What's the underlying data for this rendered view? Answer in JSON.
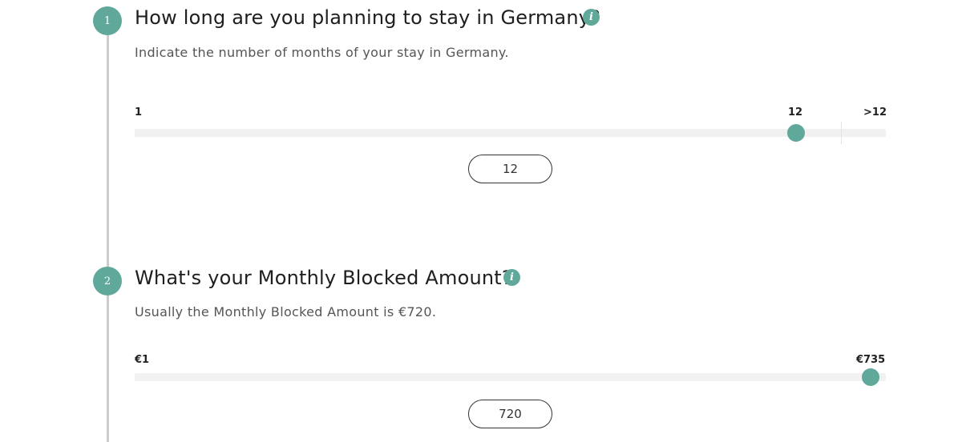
{
  "steps": [
    {
      "number": "1",
      "title": "How long are you planning to stay in Germany?",
      "description": "Indicate the number of months of your stay in Germany.",
      "info_icon": "info-icon",
      "slider": {
        "min_label": "1",
        "current_label": "12",
        "max_label": ">12",
        "value": 12,
        "input_value": "12"
      }
    },
    {
      "number": "2",
      "title": "What's your Monthly Blocked Amount?",
      "description": "Usually the Monthly Blocked Amount is €720.",
      "info_icon": "info-icon",
      "slider": {
        "min_label": "€1",
        "max_label": "€735",
        "value": 720,
        "input_value": "720"
      }
    }
  ],
  "colors": {
    "accent": "#5fa89a",
    "timeline": "#cccccc",
    "track": "#f1f1f1"
  }
}
